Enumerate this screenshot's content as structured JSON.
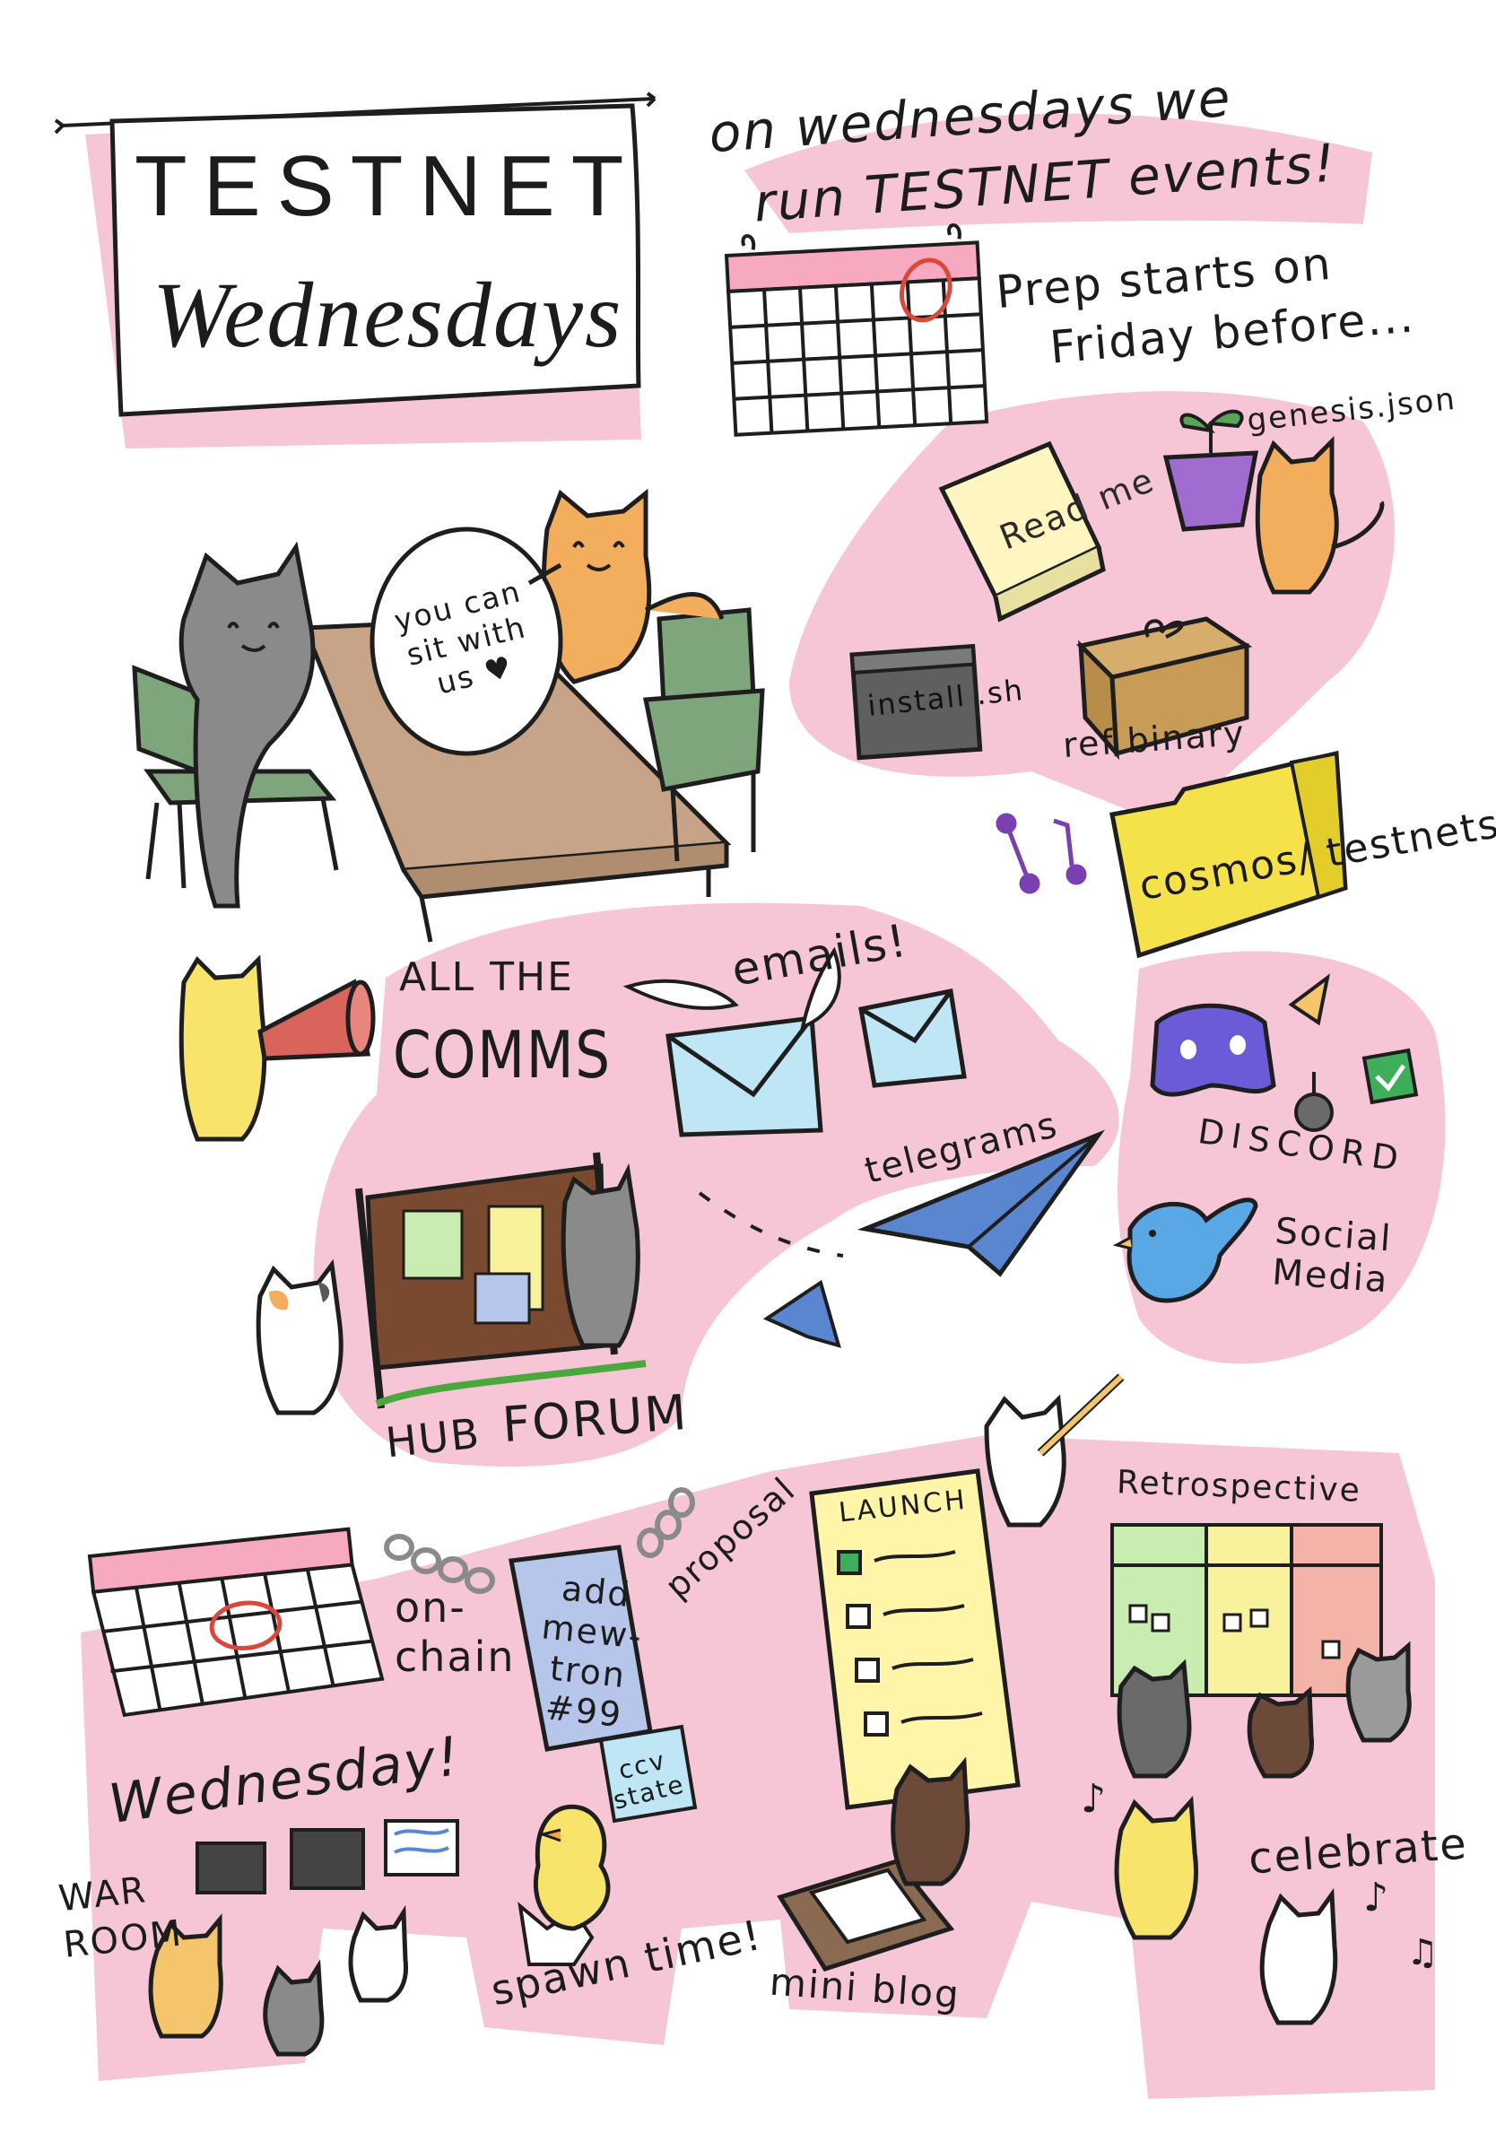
{
  "title": {
    "line1": "TESTNET",
    "line2": "Wednesdays"
  },
  "tagline": {
    "line1": "on wednesdays we",
    "line2": "run TESTNET events!"
  },
  "prep": {
    "line1": "Prep starts on",
    "line2": "Friday before..."
  },
  "items": {
    "genesis": "genesis.json",
    "readme": "Read me",
    "install": "install .sh",
    "ref_binary": "ref binary",
    "repo": "cosmos/ testnets"
  },
  "bubble": "you can sit with us ♥",
  "comms": {
    "all_the": "ALL THE",
    "comms": "COMMS",
    "emails": "emails!",
    "telegrams": "telegrams",
    "discord": "DISCORD",
    "social_media": "Social Media",
    "hub": "HUB",
    "forum": "FORUM"
  },
  "chain": {
    "on_chain": "on- chain",
    "proposal_text": "add mew- tron #99",
    "proposal": "proposal"
  },
  "launch": {
    "heading": "LAUNCH"
  },
  "retro": {
    "heading": "Retrospective"
  },
  "wednesday": {
    "heading": "Wednesday!",
    "war_room": "WAR ROOM"
  },
  "spawn": {
    "ccv": "ccv state",
    "text": "spawn time!"
  },
  "blog": "mini blog",
  "celebrate": "celebrate",
  "colors": {
    "pink": "#f6c6d6",
    "ink": "#1e1e1e",
    "orange_cat": "#f2ae5d",
    "grey_cat": "#8a8a8a",
    "yellow_cat": "#f8e46a",
    "chair_green": "#7fa57d",
    "table": "#c7a487",
    "folder": "#f5e24a",
    "discord_purple": "#6b5bd6",
    "email_blue": "#bfe6f5",
    "plane_blue": "#5a86cf",
    "bird_blue": "#5aa7e6",
    "retro_green": "#c9ecb0",
    "retro_yellow": "#f7f29b",
    "retro_red": "#f3b3a8",
    "calendar_red": "#d9483b"
  }
}
